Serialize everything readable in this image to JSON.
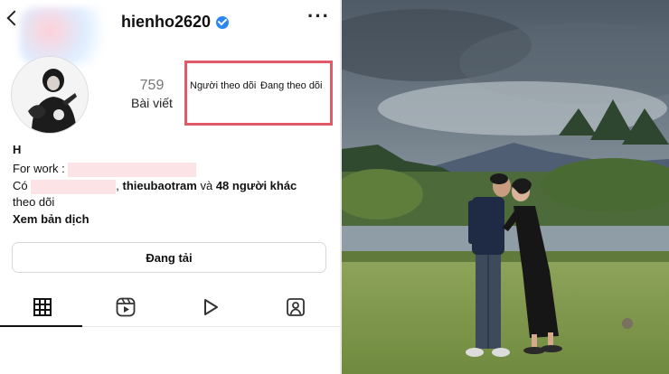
{
  "profile": {
    "username": "hienho2620",
    "verified": true,
    "avatar_icon": "profile-avatar-photo",
    "posts_count": "759",
    "posts_label": "Bài viết",
    "followers_label": "Người theo dõi",
    "following_label": "Đang theo dõi"
  },
  "bio": {
    "name": "H",
    "work_prefix": "For work :",
    "follow_prefix": "Có",
    "follow_comma": ",",
    "follow_user": "thieubaotram",
    "follow_and": "và",
    "follow_others": "48 người khác",
    "follow_suffix": "theo dõi",
    "translate_link": "Xem bản dịch"
  },
  "actions": {
    "loading_button": "Đang tải"
  },
  "tabs": [
    {
      "icon": "grid-icon",
      "active": true
    },
    {
      "icon": "reels-icon",
      "active": false
    },
    {
      "icon": "video-play-icon",
      "active": false
    },
    {
      "icon": "tagged-person-icon",
      "active": false
    }
  ],
  "colors": {
    "highlight_box": "#e05a6a",
    "verified": "#2a86f5",
    "redaction": "#fbe3e6"
  },
  "photo": {
    "icon": "couple-kissing-photo"
  }
}
